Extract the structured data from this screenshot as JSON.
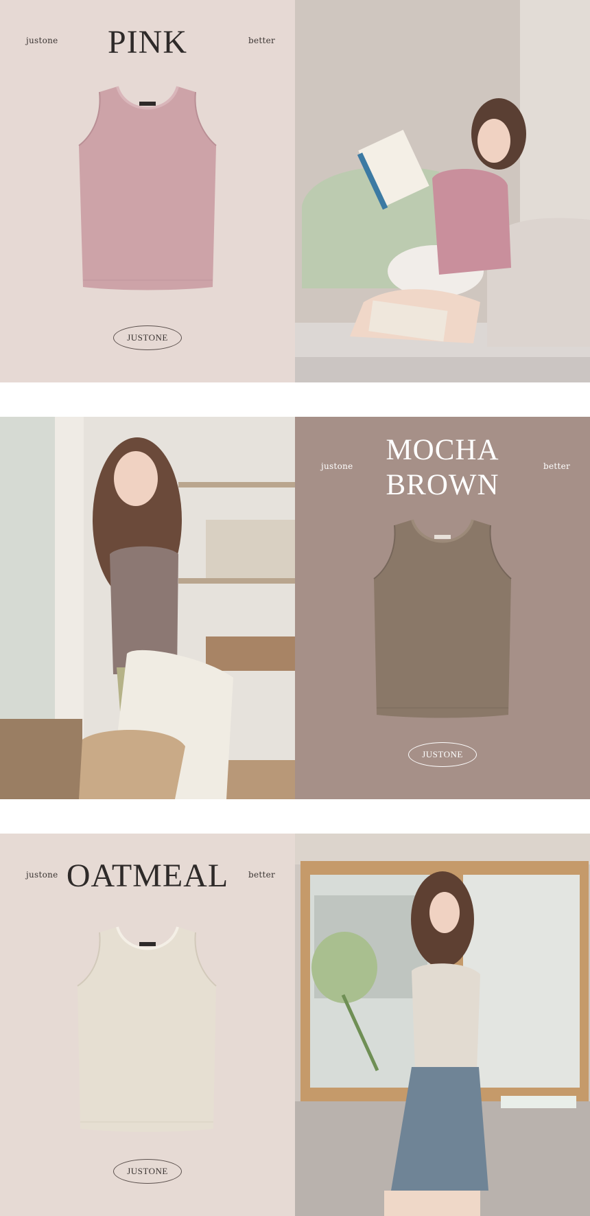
{
  "sections": [
    {
      "color_name": "PINK",
      "brand": "justone",
      "tagline": "better",
      "logo": "JUSTONE",
      "panel_bg": "#e6d9d4",
      "product_color": "#cda3a8",
      "text_color": "#2e2a29"
    },
    {
      "color_name_line1": "MOCHA",
      "color_name_line2": "BROWN",
      "brand": "justone",
      "tagline": "better",
      "logo": "JUSTONE",
      "panel_bg": "#a69088",
      "product_color": "#8a7868",
      "text_color": "#ffffff"
    },
    {
      "color_name": "OATMEAL",
      "brand": "justone",
      "tagline": "better",
      "logo": "JUSTONE",
      "panel_bg": "#e6dad4",
      "product_color": "#e6dfd2",
      "text_color": "#2e2a29"
    }
  ]
}
